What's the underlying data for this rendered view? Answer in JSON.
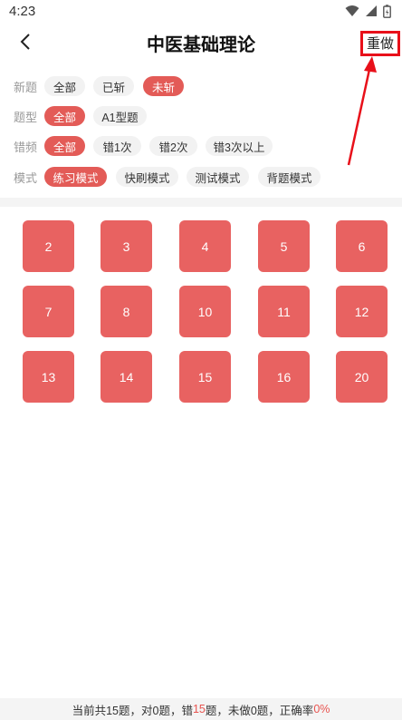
{
  "status_bar": {
    "time": "4:23"
  },
  "header": {
    "title": "中医基础理论",
    "redo_label": "重做"
  },
  "filters": {
    "new": {
      "label": "新题",
      "options": [
        "全部",
        "已斩",
        "未斩"
      ],
      "selected_index": 2
    },
    "type": {
      "label": "题型",
      "options": [
        "全部",
        "A1型题"
      ],
      "selected_index": 0
    },
    "error": {
      "label": "错频",
      "options": [
        "全部",
        "错1次",
        "错2次",
        "错3次以上"
      ],
      "selected_index": 0
    },
    "mode": {
      "label": "模式",
      "options": [
        "练习模式",
        "快刷模式",
        "测试模式",
        "背题模式"
      ],
      "selected_index": 0
    }
  },
  "questions": [
    "2",
    "3",
    "4",
    "5",
    "6",
    "7",
    "8",
    "10",
    "11",
    "12",
    "13",
    "14",
    "15",
    "16",
    "20"
  ],
  "footer": {
    "prefix": "当前共15题，对0题，错",
    "wrong": "15",
    "middle": "题，未做0题，正确率",
    "rate": "0%"
  },
  "colors": {
    "accent": "#e35b57",
    "cell": "#e86261",
    "highlight_box": "#e8101a"
  }
}
